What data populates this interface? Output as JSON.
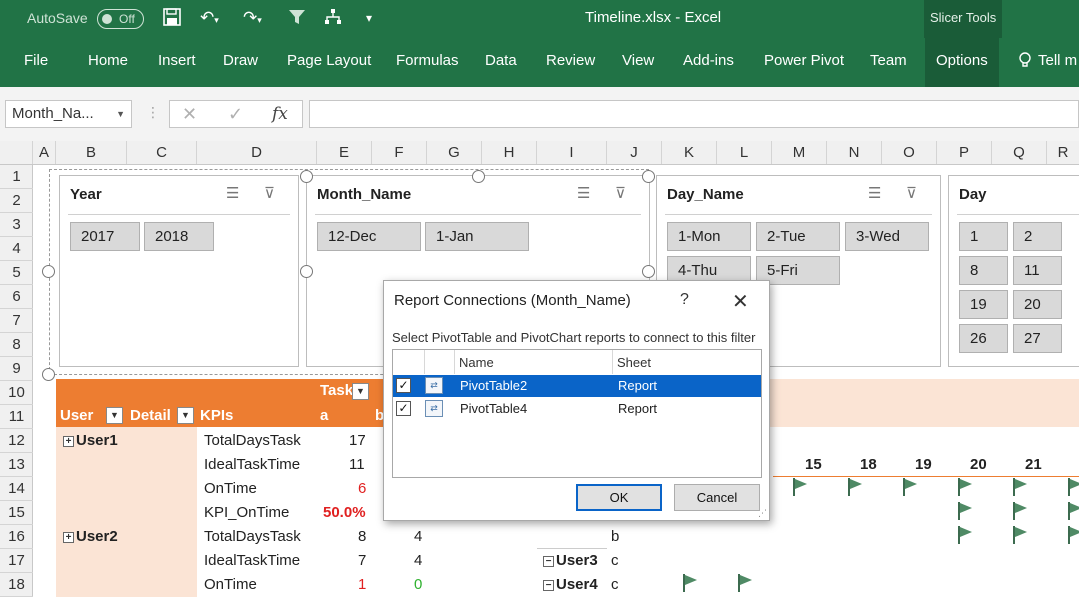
{
  "titlebar": {
    "autosave_label": "AutoSave",
    "autosave_state": "Off",
    "document_title": "Timeline.xlsx  -  Excel",
    "context_tab_group": "Slicer Tools"
  },
  "ribbon": {
    "tabs": [
      "File",
      "Home",
      "Insert",
      "Draw",
      "Page Layout",
      "Formulas",
      "Data",
      "Review",
      "View",
      "Add-ins",
      "Power Pivot",
      "Team",
      "Options",
      "Tell m"
    ],
    "active_tab": "Options"
  },
  "formula_bar": {
    "name_box": "Month_Na...",
    "fx_label": "fx",
    "formula": ""
  },
  "columns": [
    "A",
    "B",
    "C",
    "D",
    "E",
    "F",
    "G",
    "H",
    "I",
    "J",
    "K",
    "L",
    "M",
    "N",
    "O",
    "P",
    "Q",
    "R"
  ],
  "rows": [
    "1",
    "2",
    "3",
    "4",
    "5",
    "6",
    "7",
    "8",
    "9",
    "10",
    "11",
    "12",
    "13",
    "14",
    "15",
    "16",
    "17",
    "18"
  ],
  "slicers": {
    "year": {
      "title": "Year",
      "items": [
        "2017",
        "2018"
      ]
    },
    "month": {
      "title": "Month_Name",
      "items": [
        "12-Dec",
        "1-Jan"
      ]
    },
    "day_name": {
      "title": "Day_Name",
      "items": [
        "1-Mon",
        "2-Tue",
        "3-Wed",
        "4-Thu",
        "5-Fri"
      ]
    },
    "day": {
      "title": "Day",
      "items": [
        "1",
        "2",
        "8",
        "11",
        "19",
        "20",
        "26",
        "27"
      ]
    }
  },
  "pivot": {
    "header_task": "Task",
    "header_user": "User",
    "header_detail": "Detail",
    "header_kpis": "KPIs",
    "col_a": "a",
    "col_b": "b",
    "user1": "User1",
    "user2": "User2",
    "user3": "User3",
    "user4": "User4",
    "kpi_rows": [
      {
        "label": "TotalDaysTask",
        "a": "17"
      },
      {
        "label": "IdealTaskTime",
        "a": "11"
      },
      {
        "label": "OnTime",
        "a": "6"
      },
      {
        "label": "KPI_OnTime",
        "a": "50.0%"
      }
    ],
    "user2_rows": [
      {
        "label": "TotalDaysTask",
        "a": "8",
        "b": "4"
      },
      {
        "label": "IdealTaskTime",
        "a": "7",
        "b": "4"
      },
      {
        "label": "OnTime",
        "a": "1",
        "b": "0"
      }
    ],
    "right_col_letters": [
      "b",
      "c",
      "c"
    ],
    "day_headers": [
      "15",
      "18",
      "19",
      "20",
      "21"
    ],
    "colors": {
      "negative": "#e02020",
      "positive": "#2fb12f",
      "header": "#ed7d31",
      "band": "#fbe4d5"
    }
  },
  "dialog": {
    "title": "Report Connections (Month_Name)",
    "help": "?",
    "close": "✕",
    "instruction": "Select PivotTable and PivotChart reports to connect to this filter",
    "col_name": "Name",
    "col_sheet": "Sheet",
    "rows": [
      {
        "name": "PivotTable2",
        "sheet": "Report",
        "checked": true,
        "selected": true
      },
      {
        "name": "PivotTable4",
        "sheet": "Report",
        "checked": true,
        "selected": false
      }
    ],
    "ok_label": "OK",
    "cancel_label": "Cancel"
  },
  "icons": {
    "save": "save-icon",
    "undo": "undo-icon",
    "redo": "redo-icon",
    "filter": "filter-icon",
    "multiselect": "multi-select-icon",
    "clear_filter": "clear-filter-icon",
    "flag": "flag-icon",
    "lightbulb": "lightbulb-icon"
  }
}
